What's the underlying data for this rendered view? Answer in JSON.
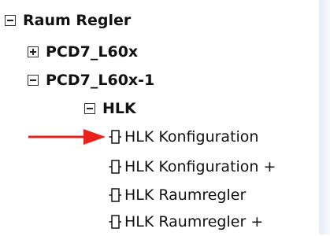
{
  "tree": {
    "root": {
      "label": "Raum Regler",
      "state": "expanded"
    },
    "child_a": {
      "label": "PCD7_L60x",
      "state": "collapsed"
    },
    "child_b": {
      "label": "PCD7_L60x-1",
      "state": "expanded"
    },
    "folder": {
      "label": "HLK",
      "state": "expanded"
    },
    "leaves": [
      {
        "label": "HLK Konfiguration",
        "icon": "function-block-icon"
      },
      {
        "label": "HLK Konfiguration +",
        "icon": "function-block-icon"
      },
      {
        "label": "HLK Raumregler",
        "icon": "function-block-icon"
      },
      {
        "label": "HLK Raumregler +",
        "icon": "function-block-icon"
      }
    ]
  },
  "colors": {
    "arrow": "#e8221b",
    "edge": "#e9eef5"
  }
}
